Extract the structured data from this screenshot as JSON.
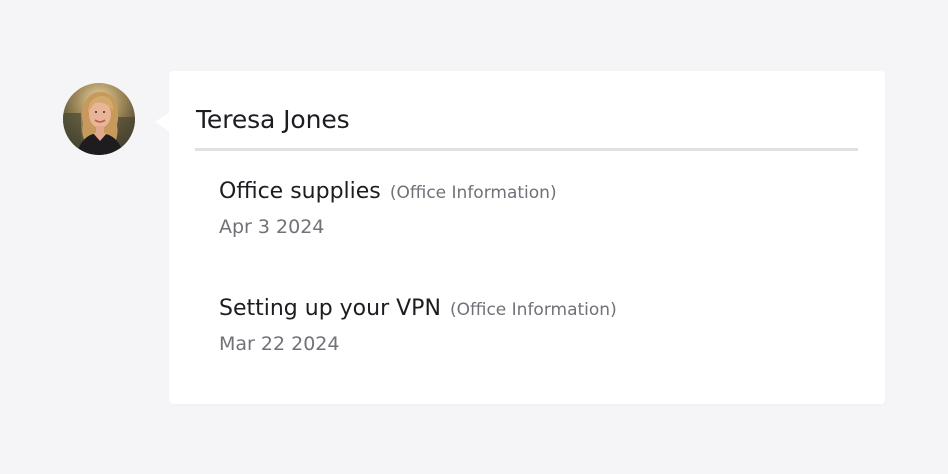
{
  "user": {
    "name": "Teresa Jones",
    "avatar_icon": "person-avatar"
  },
  "entries": [
    {
      "title": "Office supplies",
      "category": "(Office Information)",
      "date": "Apr 3 2024"
    },
    {
      "title": "Setting up your VPN",
      "category": "(Office Information)",
      "date": "Mar 22 2024"
    }
  ],
  "colors": {
    "background": "#f5f4f7",
    "card": "#ffffff",
    "divider": "#e1e1e4",
    "text_primary": "#1c1c21",
    "text_secondary": "#717179"
  }
}
